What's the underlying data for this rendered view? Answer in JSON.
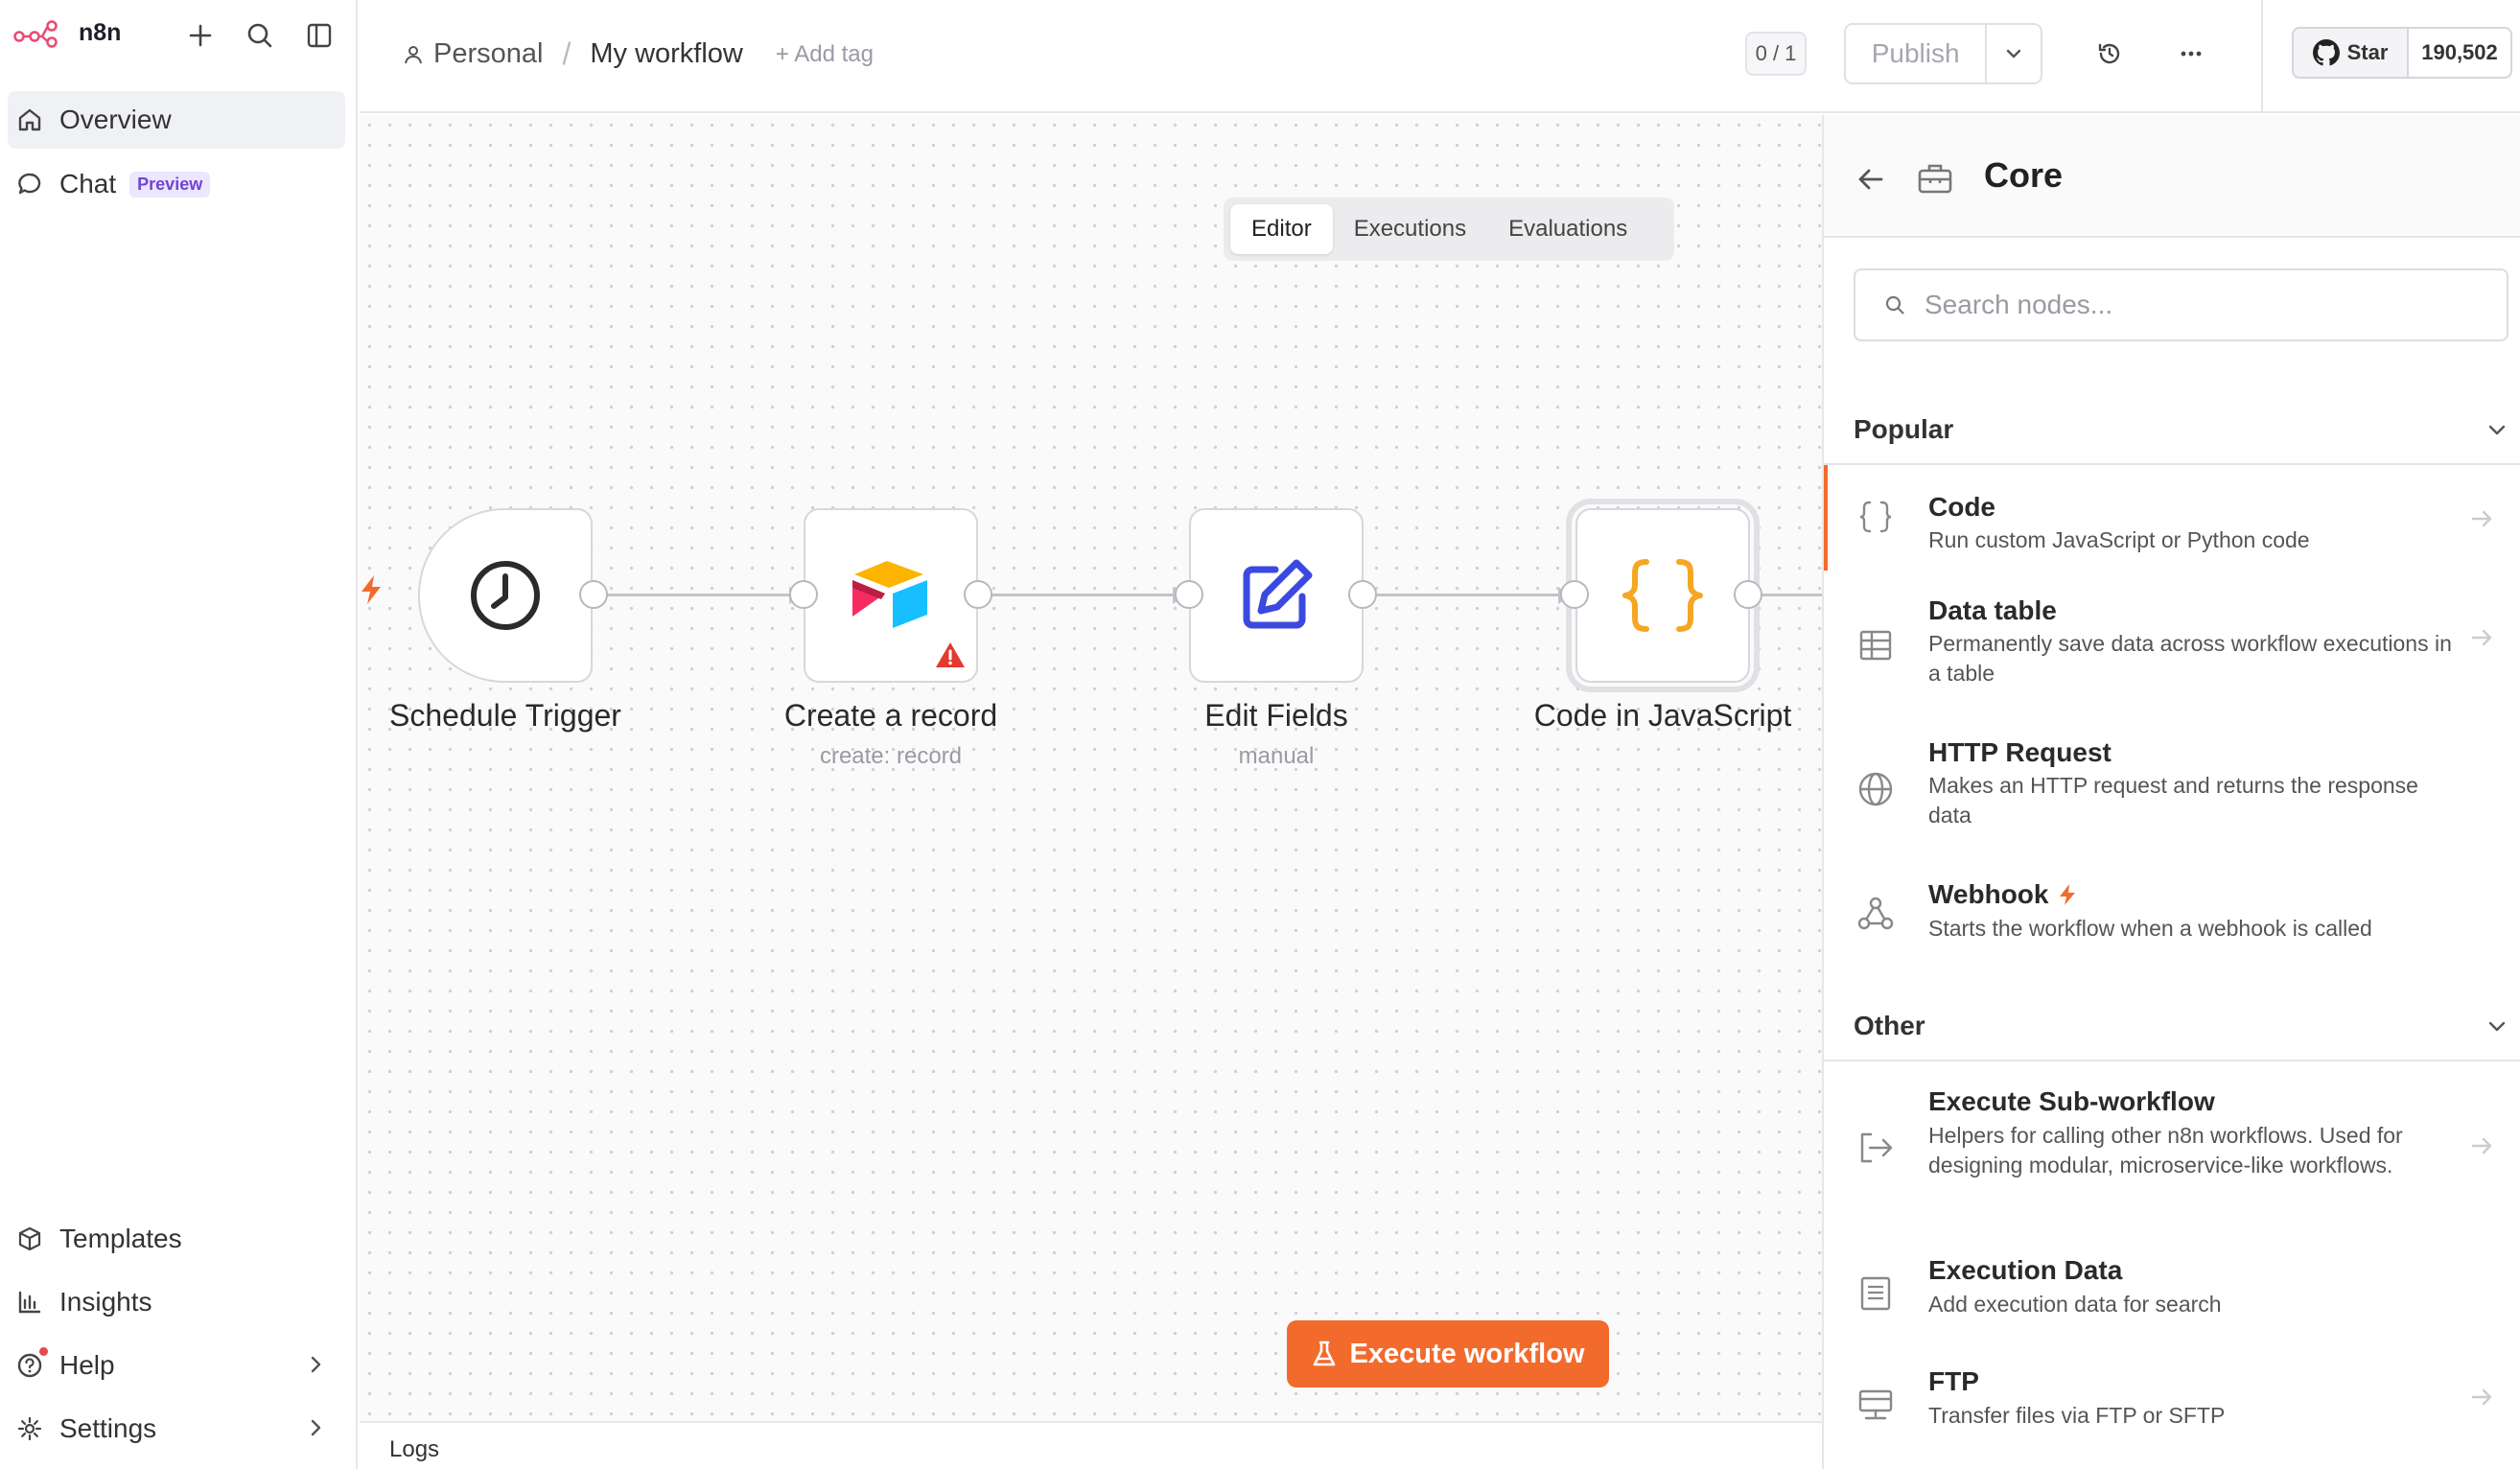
{
  "app": {
    "name": "n8n",
    "accent": "#f26b2d"
  },
  "sidebar": {
    "top_items": [
      {
        "label": "Overview",
        "icon": "home-icon",
        "active": true
      },
      {
        "label": "Chat",
        "icon": "chat-icon",
        "badge": "Preview"
      }
    ],
    "bottom_items": [
      {
        "label": "Templates",
        "icon": "box-icon"
      },
      {
        "label": "Insights",
        "icon": "bar-chart-icon"
      },
      {
        "label": "Help",
        "icon": "help-circle-icon",
        "has_chevron": true,
        "notification_dot": true
      },
      {
        "label": "Settings",
        "icon": "gear-icon",
        "has_chevron": true
      }
    ]
  },
  "header": {
    "project": "Personal",
    "workflow_name": "My workflow",
    "add_tag": "+ Add tag",
    "counter": "0 / 1",
    "publish_label": "Publish",
    "github": {
      "star_label": "Star",
      "count": "190,502"
    }
  },
  "tabs": [
    {
      "label": "Editor",
      "active": true
    },
    {
      "label": "Executions"
    },
    {
      "label": "Evaluations"
    }
  ],
  "nodes": [
    {
      "name": "Schedule Trigger",
      "subtitle": "",
      "icon": "clock-icon"
    },
    {
      "name": "Create a record",
      "subtitle": "create: record",
      "icon": "airtable-icon",
      "warning": true
    },
    {
      "name": "Edit Fields",
      "subtitle": "manual",
      "icon": "edit-icon"
    },
    {
      "name": "Code in JavaScript",
      "subtitle": "",
      "icon": "code-braces-icon",
      "selected": true
    }
  ],
  "execute_button": "Execute workflow",
  "logs_label": "Logs",
  "panel": {
    "title": "Core",
    "search_placeholder": "Search nodes...",
    "sections": [
      {
        "title": "Popular",
        "items": [
          {
            "title": "Code",
            "description": "Run custom JavaScript or Python code",
            "icon": "code-braces-icon",
            "active": true
          },
          {
            "title": "Data table",
            "description": "Permanently save data across workflow executions in a table",
            "icon": "table-icon"
          },
          {
            "title": "HTTP Request",
            "description": "Makes an HTTP request and returns the response data",
            "icon": "globe-icon"
          },
          {
            "title": "Webhook",
            "description": "Starts the workflow when a webhook is called",
            "icon": "webhook-icon",
            "trigger": true
          }
        ]
      },
      {
        "title": "Other",
        "items": [
          {
            "title": "Execute Sub-workflow",
            "description": "Helpers for calling other n8n workflows. Used for designing modular, microservice-like workflows.",
            "icon": "sign-in-icon"
          },
          {
            "title": "Execution Data",
            "description": "Add execution data for search",
            "icon": "document-icon"
          },
          {
            "title": "FTP",
            "description": "Transfer files via FTP or SFTP",
            "icon": "server-icon"
          }
        ]
      }
    ]
  }
}
